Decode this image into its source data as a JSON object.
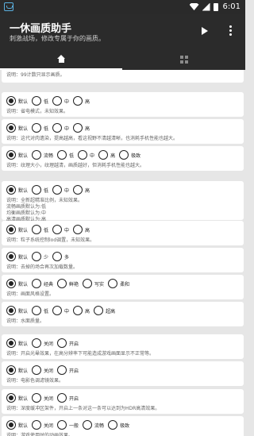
{
  "status": {
    "time": "6:01"
  },
  "app": {
    "title": "一休画质助手",
    "subtitle": "刺激战场，修改专属于你的画质。"
  },
  "icons": {
    "notification": "app-notification-icon",
    "wifi": "wifi-icon",
    "signal": "signal-icon",
    "battery": "battery-icon",
    "play": "play-icon",
    "more": "more-vert-icon",
    "home": "home-icon",
    "apps": "apps-grid-icon"
  },
  "colors": {
    "bar": "#2b2b2b",
    "background": "#e6e6e6",
    "card": "#ffffff"
  },
  "cards": [
    {
      "options": [],
      "selected": -1,
      "desc": "说明：99计数只显示画质。"
    },
    {
      "options": [
        "默认",
        "低",
        "中",
        "高"
      ],
      "selected": 0,
      "desc": "说明：省电模式，未知效果。"
    },
    {
      "options": [
        "默认",
        "低",
        "中",
        "高"
      ],
      "selected": 0,
      "desc": "说明：这代对肉遗染，提高越高，看这视野不清越清晰，也消耗手机性能也越大。"
    },
    {
      "options": [
        "默认",
        "流畅",
        "低",
        "中",
        "高",
        "极致"
      ],
      "selected": 0,
      "desc": "说明：纹理大小，纹理越清，画质越好，但消耗手机性能也越大。"
    },
    {
      "options": [
        "默认",
        "低",
        "中",
        "高"
      ],
      "selected": 0,
      "desc": "说明：全新超精准比例，未知效果。\n流畅画质默认为:低\n均衡画质默认为:中\n高清画质默认为:高"
    },
    {
      "options": [
        "默认",
        "低",
        "中",
        "高"
      ],
      "selected": 0,
      "desc": "说明：粒子系统控制lod调置，未知效果。"
    },
    {
      "options": [
        "默认",
        "少",
        "多"
      ],
      "selected": 0,
      "desc": "说明：去掉的场合再次加载数量。"
    },
    {
      "options": [
        "默认",
        "经典",
        "鲜艳",
        "写实",
        "柔和"
      ],
      "selected": 0,
      "desc": "说明：画面风格设置。"
    },
    {
      "options": [
        "默认",
        "低",
        "中",
        "高",
        "超高"
      ],
      "selected": 0,
      "desc": "说明：水面质量。"
    },
    {
      "options": [
        "默认",
        "关闭",
        "开启"
      ],
      "selected": 0,
      "desc": "说明：开启光晕效果，在高分辨率下可能造成游戏画面显示不正常等。"
    },
    {
      "options": [
        "默认",
        "关闭",
        "开启"
      ],
      "selected": 0,
      "desc": "说明：电影色调滤镜效果。"
    },
    {
      "options": [
        "默认",
        "关闭",
        "开启"
      ],
      "selected": 0,
      "desc": "说明：深度缓冲区架件，开启上一条对这一条可以达到为HDR高清效果。"
    },
    {
      "options": [
        "默认",
        "关闭",
        "一般",
        "流畅",
        "极致"
      ],
      "selected": 0,
      "desc": "说明：游戏使用时的动画效果。"
    }
  ]
}
